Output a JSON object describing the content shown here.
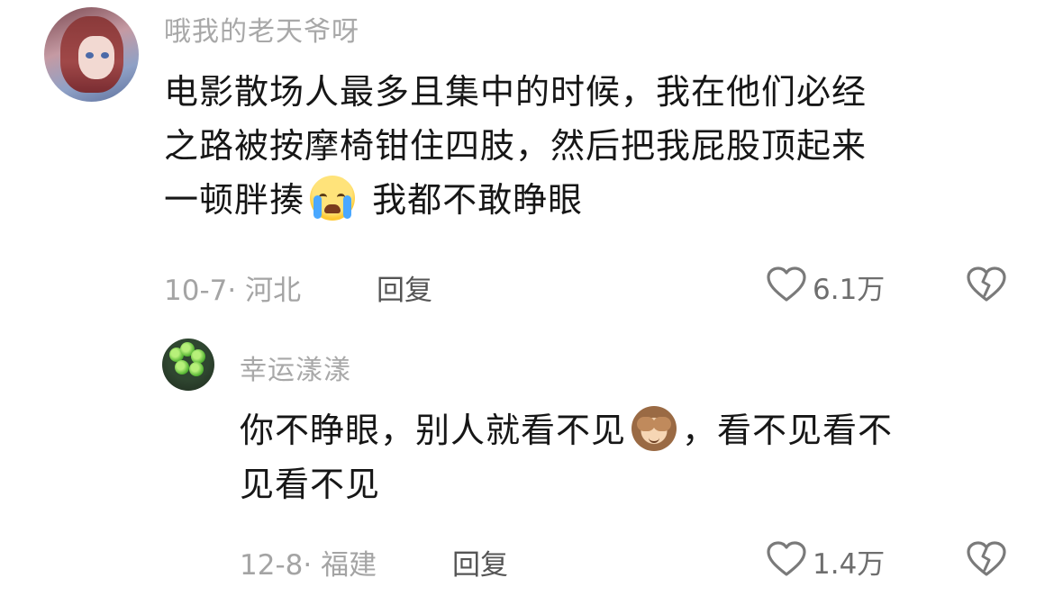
{
  "comment": {
    "username": "哦我的老天爷呀",
    "text_line1": "电影散场人最多且集中的时候，我在他们必经",
    "text_line2": "之路被按摩椅钳住四肢，然后把我屁股顶起来",
    "text_line3_before_emoji": "一顿胖揍",
    "text_line3_emoji": "loudly-crying-face-emoji",
    "text_line3_after_emoji": "我都不敢睁眼",
    "date_location": "10-7· 河北",
    "reply_label": "回复",
    "like_icon": "heart-outline-icon",
    "like_count": "6.1万",
    "dislike_icon": "broken-heart-outline-icon"
  },
  "reply": {
    "username": "幸运漾漾",
    "text_line1_before_emoji": "你不睁眼，别人就看不见",
    "text_line1_emoji": "see-no-evil-monkey-emoji",
    "text_line1_after_emoji": "，看不见看不",
    "text_line2": "见看不见",
    "date_location": "12-8· 福建",
    "reply_label": "回复",
    "like_icon": "heart-outline-icon",
    "like_count": "1.4万",
    "dislike_icon": "broken-heart-outline-icon"
  },
  "colors": {
    "username": "#a8a8a8",
    "text": "#161616",
    "meta": "#a4a4a4",
    "icon": "#7a7a7a"
  }
}
